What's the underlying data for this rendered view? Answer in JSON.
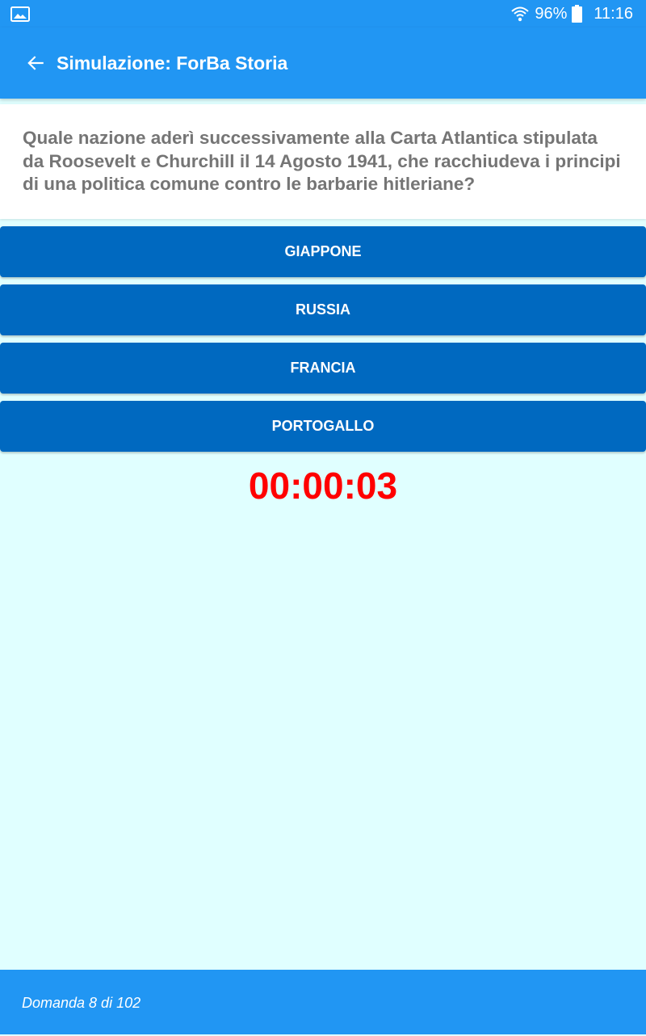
{
  "status_bar": {
    "left_icon": "gallery-icon",
    "wifi_icon": "wifi-icon",
    "battery_percent": "96%",
    "battery_icon": "battery-icon",
    "time": "11:16"
  },
  "app_bar": {
    "back_icon": "arrow-back-icon",
    "title": "Simulazione: ForBa Storia"
  },
  "question": {
    "text": "Quale nazione aderì successivamente alla Carta Atlantica stipulata da Roosevelt e Churchill il 14 Agosto 1941, che racchiudeva i principi di una politica comune contro le barbarie hitleriane?"
  },
  "answers": [
    {
      "label": "GIAPPONE"
    },
    {
      "label": "RUSSIA"
    },
    {
      "label": "FRANCIA"
    },
    {
      "label": "PORTOGALLO"
    }
  ],
  "timer": {
    "value": "00:00:03"
  },
  "footer": {
    "progress_text": "Domanda 8 di 102"
  },
  "colors": {
    "primary": "#2196f3",
    "answer_button": "#0069c0",
    "background": "#e0ffff",
    "question_text": "#757575",
    "timer": "#ff0000"
  }
}
